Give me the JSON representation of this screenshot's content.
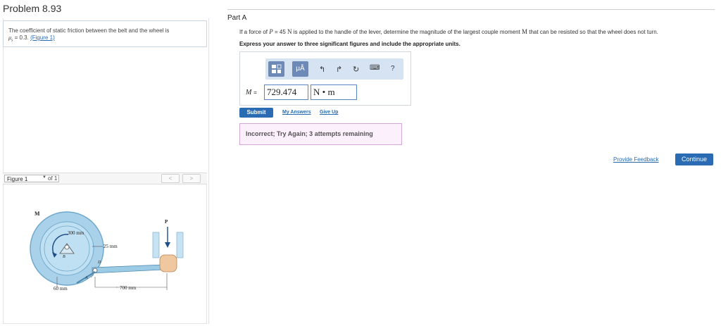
{
  "problem": {
    "title": "Problem 8.93"
  },
  "info": {
    "text": "The coefficient of static friction between the belt and the wheel is",
    "mu_symbol": "μ",
    "mu_sub": "s",
    "mu_value": "= 0.3.",
    "figure_link": "(Figure 1)"
  },
  "figure": {
    "select_label": "Figure 1",
    "of_label": "of 1",
    "prev": "<",
    "next": ">",
    "labels": {
      "m": "M",
      "p": "P",
      "r300": "300 mm",
      "r25": "25 mm",
      "a": "A",
      "b": "B",
      "d": "D",
      "d60": "60 mm",
      "d700": "700 mm"
    },
    "colors": {
      "wheel": "#a9d2ea",
      "wheel_dark": "#6fa8cb",
      "arm": "#9ccbe5",
      "hand": "#f0c8a0"
    }
  },
  "part": {
    "title": "Part A",
    "q_1": "If a force of",
    "q_p": "P",
    "q_2": "= 45",
    "q_unit": "N",
    "q_3": "is applied to the handle of the lever, determine the magnitude of the largest couple moment",
    "q_m": "M",
    "q_4": "that can be resisted so that the wheel does not turn.",
    "instructions": "Express your answer to three significant figures and include the appropriate units."
  },
  "answer": {
    "label_var": "M",
    "label_eq": "=",
    "value": "729.474",
    "unit": "N • m",
    "toolbar": {
      "template_icon": "template-icon",
      "units_label": "μÅ",
      "undo_icon": "undo-icon",
      "redo_icon": "redo-icon",
      "reset_icon": "reset-icon",
      "keyboard_icon": "keyboard-icon",
      "help_label": "?"
    }
  },
  "actions": {
    "submit": "Submit",
    "my_answers": "My Answers",
    "give_up": "Give Up"
  },
  "feedback": {
    "text": "Incorrect; Try Again; 3 attempts remaining"
  },
  "footer": {
    "provide_feedback": "Provide Feedback",
    "continue": "Continue"
  },
  "colors": {
    "accent": "#2a6bb4",
    "toolbar_bg": "#d6e3f3",
    "feedback_bg": "#fbf0fc",
    "feedback_border": "#d3a8d8"
  }
}
